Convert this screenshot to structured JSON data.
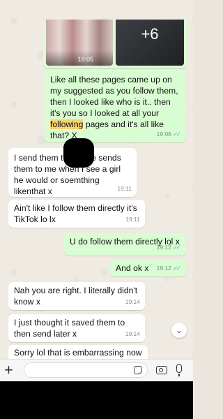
{
  "media": {
    "time": "19:05",
    "more_count": "+6"
  },
  "messages": [
    {
      "dir": "out",
      "text_before": "Like all these pages came up on my suggested as you follow them, then I looked like who is it.. then it's you so I looked at all your ",
      "highlight": "following",
      "text_after": " pages and it's all like that? X",
      "time": "19:06",
      "ticks": "✓✓"
    },
    {
      "dir": "in",
      "text": "I send them to        he sends them to me when I see a girl he would or soemthing likenthat x",
      "time": "19:11"
    },
    {
      "dir": "in",
      "text": "Ain't like I follow them directly it's TikTok lo lx",
      "time": "19:11"
    },
    {
      "dir": "out",
      "text": "U do follow them directly lol x",
      "time": "19:12",
      "ticks": "✓✓"
    },
    {
      "dir": "out",
      "text": "And ok x",
      "time": "19:12",
      "ticks": "✓✓"
    },
    {
      "dir": "in",
      "text": "Nah you are right. I literally didn't know x",
      "time": "19:14"
    },
    {
      "dir": "in",
      "text": "I just thought it saved them to then send later x",
      "time": "19:14"
    },
    {
      "dir": "in",
      "text": "Sorry lol that is embarrassing now",
      "time": ""
    }
  ],
  "input": {
    "placeholder": ""
  },
  "icons": {
    "plus": "plus-icon",
    "sticker": "sticker-icon",
    "camera": "camera-icon",
    "mic": "microphone-icon",
    "scroll": "chevron-down-icon"
  },
  "colors": {
    "outgoing_bubble": "#d9fdd3",
    "incoming_bubble": "#ffffff",
    "read_ticks": "#4fb6ec",
    "highlight": "#f7d36a"
  }
}
